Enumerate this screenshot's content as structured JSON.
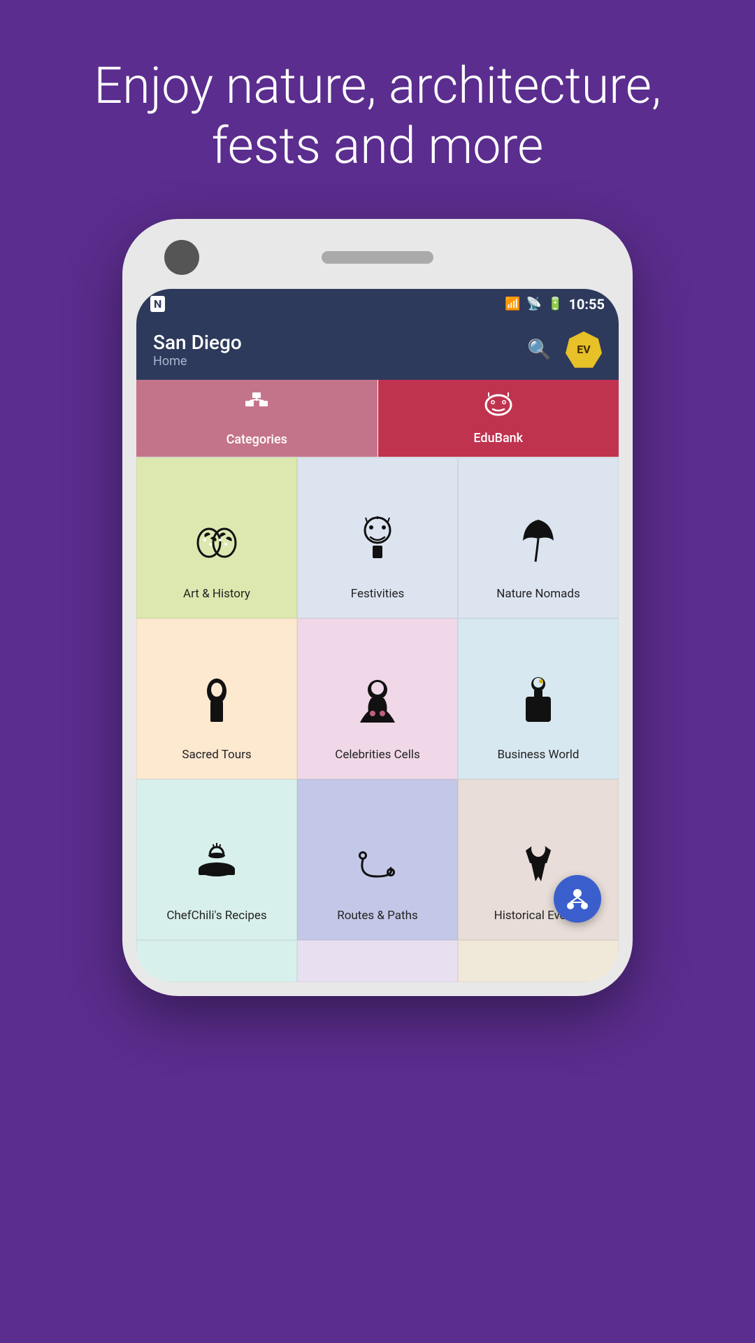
{
  "hero": {
    "tagline": "Enjoy nature, architecture, fests and more"
  },
  "status_bar": {
    "app_initial": "N",
    "time": "10:55"
  },
  "app_header": {
    "city": "San Diego",
    "subtitle": "Home",
    "logo_text": "EV"
  },
  "tabs": [
    {
      "id": "categories",
      "label": "Categories",
      "icon": "🗂"
    },
    {
      "id": "edubank",
      "label": "EduBank",
      "icon": "🦉"
    }
  ],
  "grid_cells": [
    {
      "id": "art-history",
      "label": "Art & History",
      "icon": "🎭",
      "color_class": "cell-art"
    },
    {
      "id": "festivities",
      "label": "Festivities",
      "icon": "🎠",
      "color_class": "cell-festivities"
    },
    {
      "id": "nature-nomads",
      "label": "Nature Nomads",
      "icon": "🍃",
      "color_class": "cell-nature"
    },
    {
      "id": "sacred-tours",
      "label": "Sacred Tours",
      "icon": "🧘",
      "color_class": "cell-sacred"
    },
    {
      "id": "celebrities-cells",
      "label": "Celebrities Cells",
      "icon": "🎤",
      "color_class": "cell-celebrities"
    },
    {
      "id": "business-world",
      "label": "Business World",
      "icon": "💼",
      "color_class": "cell-business"
    },
    {
      "id": "chef-recipes",
      "label": "ChefChili's Recipes",
      "icon": "🍽",
      "color_class": "cell-chef"
    },
    {
      "id": "routes-paths",
      "label": "Routes & Paths",
      "icon": "🗺",
      "color_class": "cell-routes"
    },
    {
      "id": "historical-events",
      "label": "Historical Events",
      "icon": "⚔",
      "color_class": "cell-historical"
    }
  ],
  "fab": {
    "icon": "👤"
  }
}
